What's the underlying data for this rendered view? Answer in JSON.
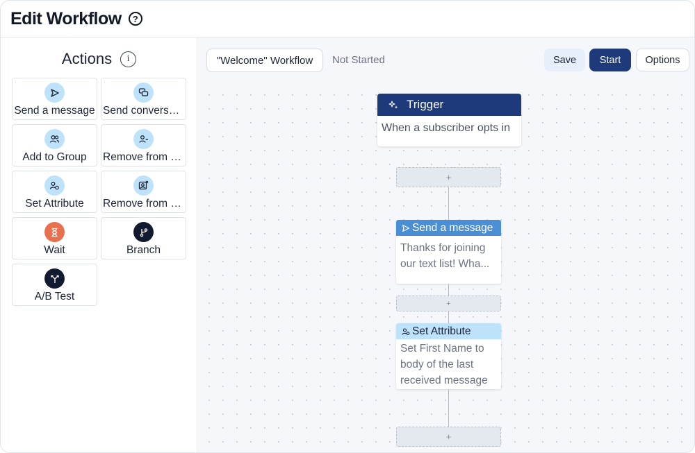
{
  "header": {
    "title": "Edit Workflow",
    "help_icon": "question-circle-icon"
  },
  "sidebar": {
    "title": "Actions",
    "info_icon": "info-icon",
    "actions": [
      {
        "label": "Send a message",
        "icon": "send-icon",
        "icon_bg": "#bfe2fb"
      },
      {
        "label": "Send conversation",
        "icon": "chat-icon",
        "icon_bg": "#bfe2fb"
      },
      {
        "label": "Add to Group",
        "icon": "users-icon",
        "icon_bg": "#bfe2fb"
      },
      {
        "label": "Remove from Group",
        "icon": "user-minus-icon",
        "icon_bg": "#bfe2fb"
      },
      {
        "label": "Set Attribute",
        "icon": "user-attribute-icon",
        "icon_bg": "#bfe2fb"
      },
      {
        "label": "Remove from Workflow",
        "icon": "remove-image-icon",
        "icon_bg": "#bfe2fb"
      },
      {
        "label": "Wait",
        "icon": "hourglass-icon",
        "icon_bg": "#e8704f"
      },
      {
        "label": "Branch",
        "icon": "branch-icon",
        "icon_bg": "#111a2e"
      },
      {
        "label": "A/B Test",
        "icon": "split-icon",
        "icon_bg": "#111a2e"
      }
    ]
  },
  "toolbar": {
    "workflow_name": "\"Welcome\" Workflow",
    "status": "Not Started",
    "save_label": "Save",
    "start_label": "Start",
    "options_label": "Options"
  },
  "canvas": {
    "trigger": {
      "title": "Trigger",
      "body": "When a subscriber opts in",
      "icon": "sparkle-icon"
    },
    "add_label": "+",
    "steps": [
      {
        "title": "Send a message",
        "body": "Thanks for joining our text list! Wha...",
        "icon": "send-icon"
      },
      {
        "title": "Set Attribute",
        "body": "Set First Name to body of the last received message",
        "icon": "user-attribute-icon"
      }
    ]
  },
  "colors": {
    "primary": "#1f3a7a",
    "send_header": "#4a8fd6",
    "attribute_header": "#bfe2fb",
    "wait_icon": "#e8704f",
    "dark_icon": "#111a2e"
  }
}
